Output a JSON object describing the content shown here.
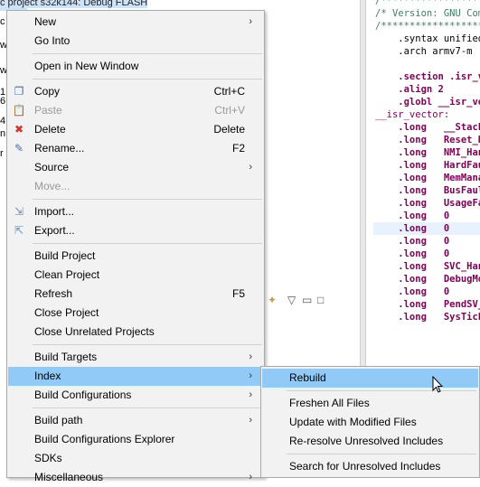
{
  "background": {
    "project_title": "c project s32k144: Debug FLASH",
    "left_fragments": [
      "c",
      "w",
      "w",
      "1",
      "6",
      "4",
      "n",
      "r"
    ],
    "toolbar_icons": [
      "pin-icon",
      "view-menu-icon",
      "minimize-icon",
      "maximize-icon"
    ],
    "editor_lines": [
      {
        "cls": "c-cmt",
        "text": "/*************************"
      },
      {
        "cls": "c-cmt",
        "text": "/* Version: GNU Compiler"
      },
      {
        "cls": "c-cmt",
        "text": "/*************************"
      },
      {
        "cls": "c-txt",
        "text": "    .syntax unified"
      },
      {
        "cls": "c-txt",
        "text": "    .arch armv7-m"
      },
      {
        "cls": "c-txt",
        "text": ""
      },
      {
        "cls": "c-dir",
        "text": "    .section .isr_vector"
      },
      {
        "cls": "c-dir",
        "text": "    .align 2"
      },
      {
        "cls": "c-dir",
        "text": "    .globl __isr_vector"
      },
      {
        "cls": "c-lbl",
        "text": "__isr_vector:"
      },
      {
        "cls": "c-dir",
        "text": "    .long   __StackTop"
      },
      {
        "cls": "c-dir",
        "text": "    .long   Reset_Handler"
      },
      {
        "cls": "c-dir",
        "text": "    .long   NMI_Handler"
      },
      {
        "cls": "c-dir",
        "text": "    .long   HardFault_Handler"
      },
      {
        "cls": "c-dir",
        "text": "    .long   MemManage_Handler"
      },
      {
        "cls": "c-dir",
        "text": "    .long   BusFault_Handler"
      },
      {
        "cls": "c-dir",
        "text": "    .long   UsageFault_Handler"
      },
      {
        "cls": "c-dir",
        "text": "    .long   0"
      },
      {
        "cls": "c-dir",
        "text": "    .long   0"
      },
      {
        "cls": "c-dir",
        "text": "    .long   0"
      },
      {
        "cls": "c-dir",
        "text": "    .long   0"
      },
      {
        "cls": "c-dir",
        "text": "    .long   SVC_Handler"
      },
      {
        "cls": "c-dir",
        "text": "    .long   DebugMon_Handler"
      },
      {
        "cls": "c-dir",
        "text": "    .long   0"
      },
      {
        "cls": "c-dir",
        "text": "    .long   PendSV_Handler"
      },
      {
        "cls": "c-dir",
        "text": "    .long   SysTick_Handler"
      }
    ]
  },
  "context_menu": {
    "items": [
      {
        "label": "New",
        "arrow": true
      },
      {
        "label": "Go Into"
      },
      {
        "sep": true
      },
      {
        "label": "Open in New Window"
      },
      {
        "sep": true
      },
      {
        "label": "Copy",
        "accel": "Ctrl+C",
        "icon": "copy-icon",
        "glyph": "❐",
        "color": "#4a6fa5"
      },
      {
        "label": "Paste",
        "accel": "Ctrl+V",
        "icon": "paste-icon",
        "glyph": "📋",
        "color": "#9a9a9a",
        "disabled": true
      },
      {
        "label": "Delete",
        "accel": "Delete",
        "icon": "delete-icon",
        "glyph": "✖",
        "color": "#d9302c"
      },
      {
        "label": "Rename...",
        "accel": "F2",
        "icon": "rename-icon",
        "glyph": "✎",
        "color": "#4a6fa5"
      },
      {
        "label": "Source",
        "arrow": true
      },
      {
        "label": "Move...",
        "disabled": true
      },
      {
        "sep": true
      },
      {
        "label": "Import...",
        "icon": "import-icon",
        "glyph": "⇲",
        "color": "#6a8fb5"
      },
      {
        "label": "Export...",
        "icon": "export-icon",
        "glyph": "⇱",
        "color": "#6a8fb5"
      },
      {
        "sep": true
      },
      {
        "label": "Build Project"
      },
      {
        "label": "Clean Project"
      },
      {
        "label": "Refresh",
        "accel": "F5"
      },
      {
        "label": "Close Project"
      },
      {
        "label": "Close Unrelated Projects"
      },
      {
        "sep": true
      },
      {
        "label": "Build Targets",
        "arrow": true
      },
      {
        "label": "Index",
        "arrow": true,
        "hover": true
      },
      {
        "label": "Build Configurations",
        "arrow": true
      },
      {
        "sep": true
      },
      {
        "label": "Build path",
        "arrow": true
      },
      {
        "label": "Build Configurations Explorer"
      },
      {
        "label": "SDKs"
      },
      {
        "label": "Miscellaneous",
        "arrow": true
      }
    ]
  },
  "submenu": {
    "items": [
      {
        "label": "Rebuild",
        "hover": true
      },
      {
        "sep": true
      },
      {
        "label": "Freshen All Files"
      },
      {
        "label": "Update with Modified Files"
      },
      {
        "label": "Re-resolve Unresolved Includes"
      },
      {
        "sep": true
      },
      {
        "label": "Search for Unresolved Includes"
      }
    ]
  }
}
